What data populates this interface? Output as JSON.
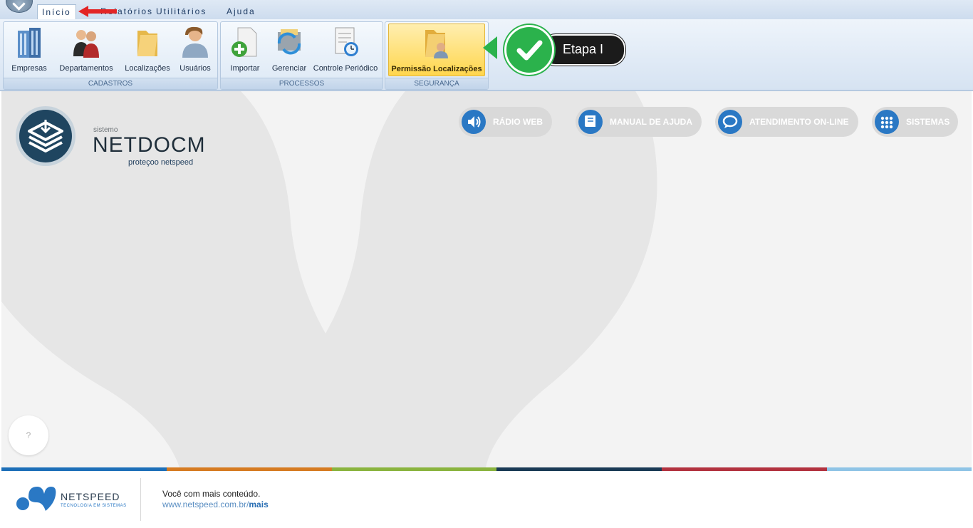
{
  "menu": {
    "tabs": [
      {
        "label": "Início",
        "active": true
      },
      {
        "label": "Relatórios"
      },
      {
        "label": "Utilitários"
      },
      {
        "label": "Ajuda"
      }
    ]
  },
  "ribbon": {
    "groups": [
      {
        "label": "CADASTROS",
        "buttons": [
          {
            "label": "Empresas",
            "icon": "building-icon"
          },
          {
            "label": "Departamentos",
            "icon": "people-icon"
          },
          {
            "label": "Localizações",
            "icon": "folder-icon"
          },
          {
            "label": "Usuários",
            "icon": "user-icon"
          }
        ]
      },
      {
        "label": "PROCESSOS",
        "buttons": [
          {
            "label": "Importar",
            "icon": "import-icon"
          },
          {
            "label": "Gerenciar",
            "icon": "manage-icon"
          },
          {
            "label": "Controle Periódico",
            "icon": "clock-doc-icon"
          }
        ]
      },
      {
        "label": "SEGURANÇA",
        "buttons": [
          {
            "label": "Permissão Localizações",
            "icon": "folder-user-icon",
            "selected": true
          }
        ]
      }
    ]
  },
  "brand": {
    "small": "sistemo",
    "name": "NETDOCM",
    "tagline": "proteçoo netspeed"
  },
  "header_buttons": [
    {
      "label": "RÁDIO WEB",
      "icon": "speaker-icon"
    },
    {
      "label": "MANUAL DE AJUDA",
      "icon": "book-icon"
    },
    {
      "label": "ATENDIMENTO ON-LINE",
      "icon": "chat-icon"
    },
    {
      "label": "SISTEMAS",
      "icon": "grid-icon"
    }
  ],
  "help_button": "?",
  "callout": {
    "label": "Etapa I",
    "color": "#2bb24c"
  },
  "footer": {
    "company": "NETSPEED",
    "company_tag": "TECNOLOGIA EM SISTEMAS",
    "line1": "Você com mais conteúdo.",
    "url_prefix": "www.netspeed.com.br/",
    "url_suffix": "mais"
  },
  "colors": {
    "stripe": [
      "#1d6fb8",
      "#d67b22",
      "#8ab43f",
      "#1a3a55",
      "#b2323f",
      "#8fc4e6"
    ],
    "accent": "#2a78c4"
  }
}
